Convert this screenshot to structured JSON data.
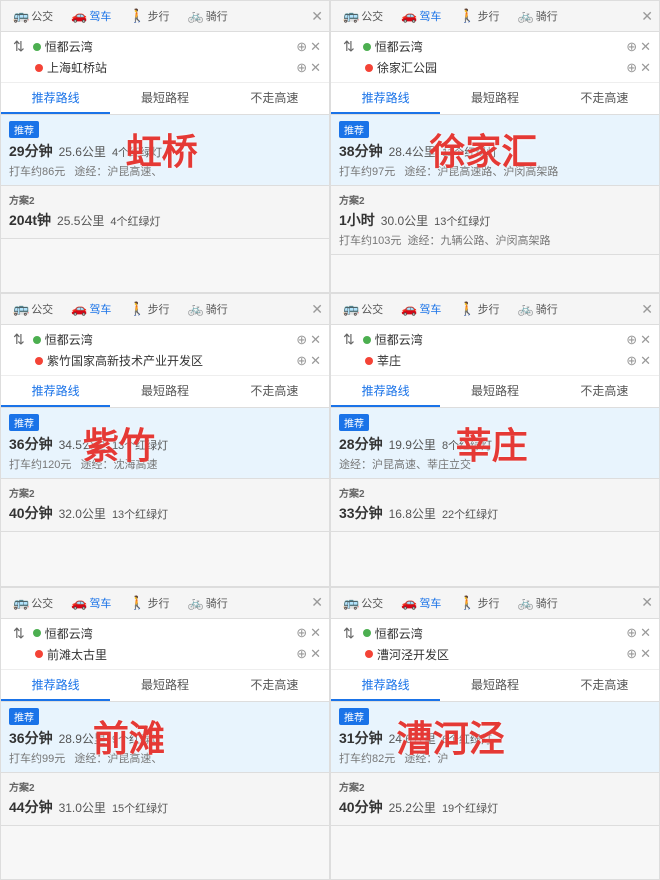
{
  "panels": [
    {
      "id": "panel-hongqiao",
      "origin": "恒都云湾",
      "destination": "上海虹桥站",
      "overlay": "虹桥",
      "overlayColor": "red",
      "overlayStyle": "top:42%; left:38%; font-size:36px;",
      "recommend": {
        "label": "推荐",
        "time": "29分钟",
        "dist": "25.6公里",
        "lights": "4个红绿灯",
        "cost": "打车约86元",
        "via": "途经：沪昆高速、"
      },
      "alt": {
        "label": "方案2",
        "time": "204t钟",
        "dist": "25.5公里",
        "lights": "4个红绿灯"
      }
    },
    {
      "id": "panel-xujiahui",
      "origin": "恒都云湾",
      "destination": "徐家汇公园",
      "overlay": "徐家汇",
      "overlayColor": "red",
      "overlayStyle": "top:42%; left:30%; font-size:36px;",
      "recommend": {
        "label": "推荐",
        "time": "38分钟",
        "dist": "28.4公里",
        "lights": "11个红绿灯",
        "cost": "打车约97元",
        "via": "途经：沪昆高速路、沪闵高架路"
      },
      "alt": {
        "label": "方案2",
        "time": "1小时",
        "dist": "30.0公里",
        "lights": "13个红绿灯",
        "cost": "打车约103元",
        "via": "途经：九辆公路、沪闵高架路"
      }
    },
    {
      "id": "panel-zizhu",
      "origin": "恒都云湾",
      "destination": "紫竹国家高新技术产业开发区",
      "overlay": "紫竹",
      "overlayColor": "red",
      "overlayStyle": "top:42%; left:25%; font-size:36px;",
      "recommend": {
        "label": "推荐",
        "time": "36分钟",
        "dist": "34.5公里",
        "lights": "13个红绿灯",
        "cost": "打车约120元",
        "via": "途经：沈海高速"
      },
      "alt": {
        "label": "方案2",
        "time": "40分钟",
        "dist": "32.0公里",
        "lights": "13个红绿灯"
      }
    },
    {
      "id": "panel-xincun",
      "origin": "恒都云湾",
      "destination": "莘庄",
      "overlay": "莘庄",
      "overlayColor": "red",
      "overlayStyle": "top:42%; left:38%; font-size:36px;",
      "recommend": {
        "label": "推荐",
        "time": "28分钟",
        "dist": "19.9公里",
        "lights": "8个红绿灯",
        "cost": "",
        "via": "途经：沪昆高速、莘庄立交"
      },
      "alt": {
        "label": "方案2",
        "time": "33分钟",
        "dist": "16.8公里",
        "lights": "22个红绿灯"
      }
    },
    {
      "id": "panel-qiantan",
      "origin": "恒都云湾",
      "destination": "前滩太古里",
      "overlay": "前滩",
      "overlayColor": "red",
      "overlayStyle": "top:42%; left:28%; font-size:36px;",
      "recommend": {
        "label": "推荐",
        "time": "36分钟",
        "dist": "28.9公里",
        "lights": "9个红绿灯",
        "cost": "打车约99元",
        "via": "途经：沪昆高速、"
      },
      "alt": {
        "label": "方案2",
        "time": "44分钟",
        "dist": "31.0公里",
        "lights": "15个红绿灯"
      }
    },
    {
      "id": "panel-caohe",
      "origin": "恒都云湾",
      "destination": "漕河泾开发区",
      "overlay": "漕河泾",
      "overlayColor": "red",
      "overlayStyle": "top:42%; left:20%; font-size:36px;",
      "recommend": {
        "label": "推荐",
        "time": "31分钟",
        "dist": "24.6公里",
        "lights": "6个红绿灯",
        "cost": "打车约82元",
        "via": "途经：沪"
      },
      "alt": {
        "label": "方案2",
        "time": "40分钟",
        "dist": "25.2公里",
        "lights": "19个红绿灯"
      }
    }
  ],
  "transport": {
    "bus": "公交",
    "car": "驾车",
    "walk": "步行",
    "bike": "骑行"
  },
  "tabs": {
    "recommend": "推荐路线",
    "shortest": "最短路程",
    "noHighway": "不走高速"
  }
}
